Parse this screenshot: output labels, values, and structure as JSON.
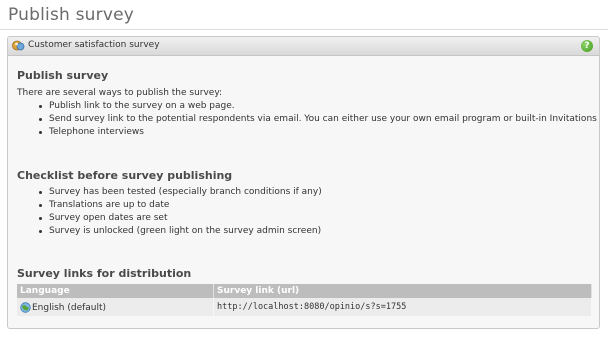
{
  "page": {
    "title": "Publish survey"
  },
  "panel": {
    "header_title": "Customer satisfaction survey",
    "help_label": "?"
  },
  "publish": {
    "heading": "Publish survey",
    "intro": "There are several ways to publish the survey:",
    "items": [
      "Publish link to the survey on a web page.",
      "Send survey link to the potential respondents via email. You can either use your own email program or built-in Invitations module.",
      "Telephone interviews"
    ]
  },
  "checklist": {
    "heading": "Checklist before survey publishing",
    "items": [
      "Survey has been tested (especially branch conditions if any)",
      "Translations are up to date",
      "Survey open dates are set",
      "Survey is unlocked (green light on the survey admin screen)"
    ]
  },
  "links": {
    "heading": "Survey links for distribution",
    "columns": [
      "Language",
      "Survey link (url)"
    ],
    "rows": [
      {
        "language": "English (default)",
        "url": "http://localhost:8080/opinio/s?s=1755"
      }
    ]
  }
}
